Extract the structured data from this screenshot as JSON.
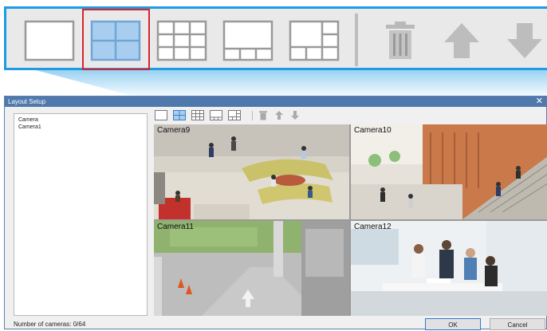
{
  "dialog": {
    "title": "Layout Setup",
    "close_glyph": "✕"
  },
  "camera_list": {
    "items": [
      "Camera",
      "Camera1"
    ]
  },
  "status": {
    "camera_count": "Number of cameras: 0/64"
  },
  "grid": {
    "tiles": [
      {
        "label": "Camera9"
      },
      {
        "label": "Camera10"
      },
      {
        "label": "Camera11"
      },
      {
        "label": "Camera12"
      }
    ]
  },
  "buttons": {
    "ok": "OK",
    "cancel": "Cancel"
  },
  "toolbar": {
    "layouts": [
      "layout-1x1-icon",
      "layout-2x2-icon",
      "layout-3x3-icon",
      "layout-1plus3-icon",
      "layout-1plus5-icon"
    ],
    "selected_layout": "layout-2x2-icon",
    "actions": [
      "delete-icon",
      "move-up-icon",
      "move-down-icon"
    ]
  },
  "colors": {
    "highlight_border": "#1e9be3",
    "selection": "#d8232a",
    "titlebar": "#4f79ad"
  }
}
